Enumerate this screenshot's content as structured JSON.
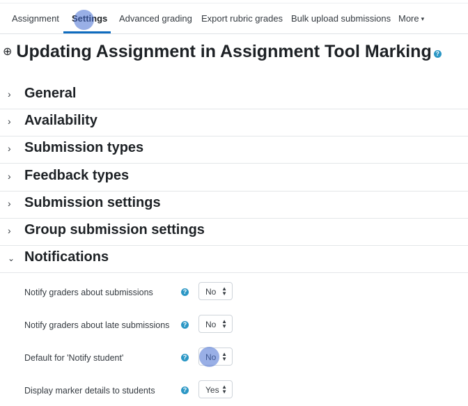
{
  "nav": {
    "tabs": [
      {
        "label": "Assignment"
      },
      {
        "label": "Settings"
      },
      {
        "label": "Advanced grading"
      },
      {
        "label": "Export rubric grades"
      },
      {
        "label": "Bulk upload submissions"
      },
      {
        "label": "More"
      }
    ],
    "active_tab": "Settings"
  },
  "page": {
    "title": "Updating Assignment in Assignment Tool Marking",
    "help_symbol": "?"
  },
  "sections": [
    {
      "title": "General",
      "expanded": false
    },
    {
      "title": "Availability",
      "expanded": false
    },
    {
      "title": "Submission types",
      "expanded": false
    },
    {
      "title": "Feedback types",
      "expanded": false
    },
    {
      "title": "Submission settings",
      "expanded": false
    },
    {
      "title": "Group submission settings",
      "expanded": false
    },
    {
      "title": "Notifications",
      "expanded": true
    }
  ],
  "notifications": {
    "fields": [
      {
        "label": "Notify graders about submissions",
        "value": "No"
      },
      {
        "label": "Notify graders about late submissions",
        "value": "No"
      },
      {
        "label": "Default for 'Notify student'",
        "value": "No"
      },
      {
        "label": "Display marker details to students",
        "value": "Yes"
      }
    ]
  },
  "colors": {
    "accent": "#0f6cbf",
    "help_icon": "#2b97c5",
    "click_marker": "#466ed2"
  }
}
